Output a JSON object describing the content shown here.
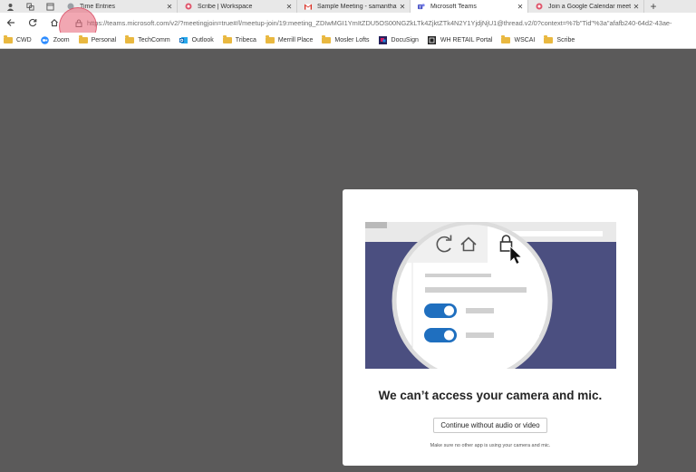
{
  "browser": {
    "tabs": [
      {
        "title": "Time Entries",
        "icon": "page-icon",
        "active": false
      },
      {
        "title": "Scribe | Workspace",
        "icon": "scribe-icon",
        "active": false
      },
      {
        "title": "Sample Meeting - samanthakay@",
        "icon": "gmail-icon",
        "active": false
      },
      {
        "title": "Microsoft Teams",
        "icon": "teams-icon",
        "active": true
      },
      {
        "title": "Join a Google Calendar meeting",
        "icon": "scribe-icon",
        "active": false
      }
    ],
    "close_glyph": "✕",
    "new_tab_glyph": "+",
    "url": "https://teams.microsoft.com/v2/?meetingjoin=true#/l/meetup-join/19:meeting_ZDIwMGI1YmItZDU5OS00NGZkLTk4ZjktZTk4N2Y1YjdjNjU1@thread.v2/0?context=%7b\"Tid\"%3a\"afafb240-64d2-43ae-"
  },
  "bookmarks": [
    {
      "label": "CWD",
      "icon": "folder-icon"
    },
    {
      "label": "Zoom",
      "icon": "zoom-icon"
    },
    {
      "label": "Personal",
      "icon": "folder-icon"
    },
    {
      "label": "TechComm",
      "icon": "folder-icon"
    },
    {
      "label": "Outlook",
      "icon": "outlook-icon"
    },
    {
      "label": "Tribeca",
      "icon": "folder-icon"
    },
    {
      "label": "Merrill Place",
      "icon": "folder-icon"
    },
    {
      "label": "Mosler Lofts",
      "icon": "folder-icon"
    },
    {
      "label": "DocuSign",
      "icon": "docusign-icon"
    },
    {
      "label": "WH RETAIL Portal",
      "icon": "wh-icon"
    },
    {
      "label": "WSCAI",
      "icon": "folder-icon"
    },
    {
      "label": "Scribe",
      "icon": "folder-icon"
    }
  ],
  "dialog": {
    "title": "We can’t access your camera and mic.",
    "button_label": "Continue without audio or video",
    "note": "Make sure no other app is using your camera and mic."
  },
  "colors": {
    "page_bg": "#5b5a5a",
    "teams_purple": "#4b4f80",
    "toggle_blue": "#1f6fbf",
    "click_highlight": "#e65f73"
  }
}
